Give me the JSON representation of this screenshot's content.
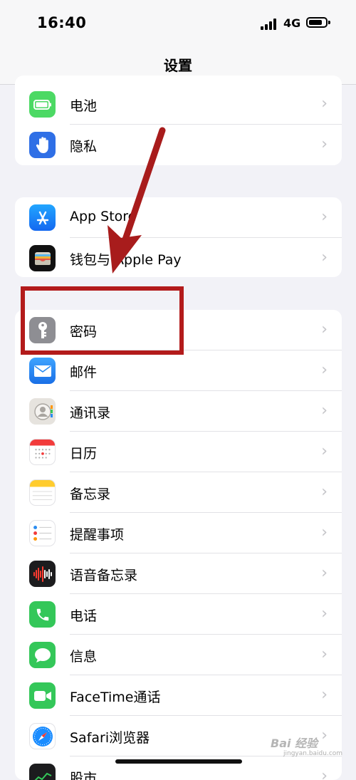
{
  "status_bar": {
    "time": "16:40",
    "network": "4G"
  },
  "nav": {
    "title": "设置"
  },
  "groups": [
    {
      "items": [
        {
          "label": "电池",
          "icon": "battery-icon"
        },
        {
          "label": "隐私",
          "icon": "hand-icon"
        }
      ]
    },
    {
      "items": [
        {
          "label": "App Store",
          "icon": "app-store-icon"
        },
        {
          "label": "钱包与 Apple Pay",
          "icon": "wallet-icon"
        }
      ]
    },
    {
      "items": [
        {
          "label": "密码",
          "icon": "key-icon"
        },
        {
          "label": "邮件",
          "icon": "mail-icon"
        },
        {
          "label": "通讯录",
          "icon": "contacts-icon"
        },
        {
          "label": "日历",
          "icon": "calendar-icon"
        },
        {
          "label": "备忘录",
          "icon": "notes-icon"
        },
        {
          "label": "提醒事项",
          "icon": "reminders-icon"
        },
        {
          "label": "语音备忘录",
          "icon": "voice-memos-icon"
        },
        {
          "label": "电话",
          "icon": "phone-icon"
        },
        {
          "label": "信息",
          "icon": "messages-icon"
        },
        {
          "label": "FaceTime通话",
          "icon": "facetime-icon"
        },
        {
          "label": "Safari浏览器",
          "icon": "safari-icon"
        },
        {
          "label": "股市",
          "icon": "stocks-icon"
        }
      ]
    }
  ],
  "watermark": {
    "text": "Bai 经验",
    "sub": "jingyan.baidu.com"
  },
  "colors": {
    "annotation": "#b31b1b",
    "battery_green": "#4cd964",
    "privacy_blue": "#2f6fe6",
    "appstore_blue": "#1a8cff",
    "key_gray": "#8e8e93",
    "mail_blue": "#2a8cf0",
    "phone_green": "#34c759"
  }
}
